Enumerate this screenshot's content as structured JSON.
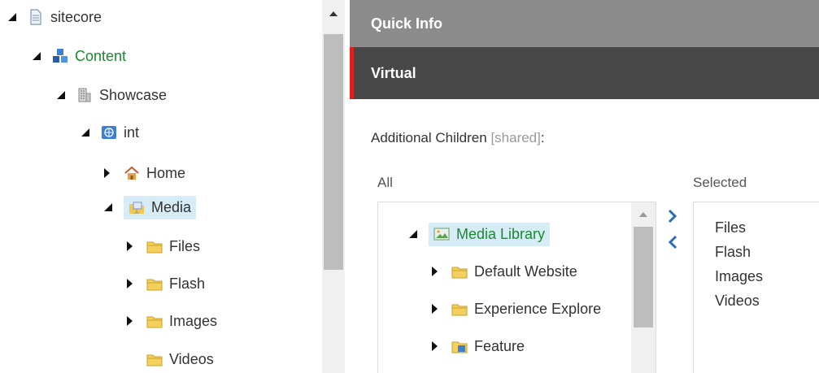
{
  "tree": {
    "items": [
      {
        "label": "sitecore",
        "state": "expanded",
        "icon": "document-icon"
      },
      {
        "label": "Content",
        "state": "expanded",
        "icon": "content-cubes-icon"
      },
      {
        "label": "Showcase",
        "state": "expanded",
        "icon": "building-icon"
      },
      {
        "label": "int",
        "state": "expanded",
        "icon": "globe-icon"
      },
      {
        "label": "Home",
        "state": "collapsed",
        "icon": "home-icon"
      },
      {
        "label": "Media",
        "state": "expanded",
        "icon": "media-folder-icon",
        "selected": true
      },
      {
        "label": "Files",
        "state": "collapsed",
        "icon": "folder-icon"
      },
      {
        "label": "Flash",
        "state": "collapsed",
        "icon": "folder-icon"
      },
      {
        "label": "Images",
        "state": "collapsed",
        "icon": "folder-icon"
      },
      {
        "label": "Videos",
        "state": "leaf",
        "icon": "folder-icon"
      }
    ]
  },
  "editor": {
    "quick_info": "Quick Info",
    "virtual": "Virtual",
    "field_label": "Additional Children",
    "field_shared": "[shared]",
    "field_colon": ":",
    "all_label": "All",
    "selected_label": "Selected",
    "all_items": [
      {
        "label": "Media Library",
        "state": "expanded",
        "icon": "media-library-icon",
        "selected": true
      },
      {
        "label": "Default Website",
        "state": "collapsed",
        "icon": "folder-icon"
      },
      {
        "label": "Experience Explore",
        "state": "collapsed",
        "icon": "folder-icon"
      },
      {
        "label": "Feature",
        "state": "collapsed",
        "icon": "feature-folder-icon"
      }
    ],
    "selected_items": [
      "Files",
      "Flash",
      "Images",
      "Videos"
    ],
    "move_right": "›",
    "move_left": "‹"
  },
  "colors": {
    "accent_red": "#d92121",
    "selection_bg": "#d6ecf6",
    "link_blue": "#2a6ebb",
    "content_green": "#1a8a2e"
  }
}
